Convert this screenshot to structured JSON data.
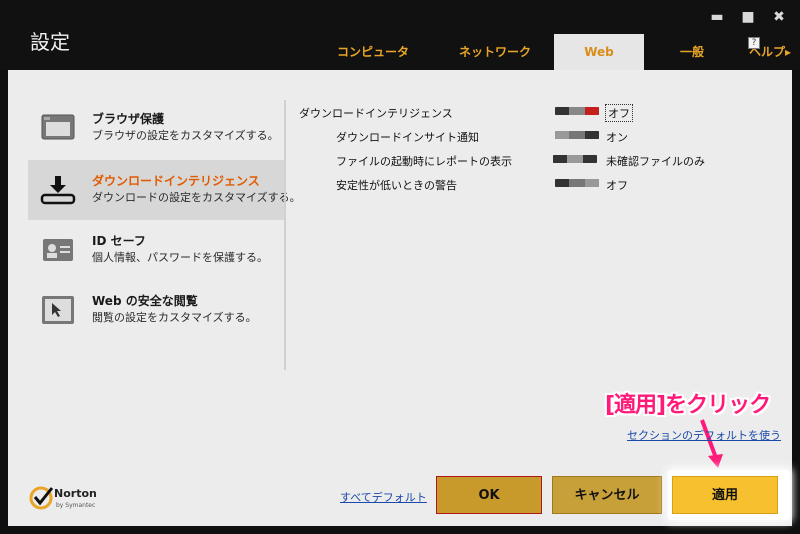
{
  "window": {
    "title": "設定",
    "controls": {
      "minimize": "▬",
      "maximize": "■",
      "close": "✖"
    }
  },
  "tabs": [
    {
      "label": "コンピュータ",
      "active": false
    },
    {
      "label": "ネットワーク",
      "active": false
    },
    {
      "label": "Web",
      "active": true
    },
    {
      "label": "一般",
      "active": false
    },
    {
      "label": "ヘルプ",
      "active": false,
      "suffix": "▸"
    }
  ],
  "sidebar": {
    "items": [
      {
        "title": "ブラウザ保護",
        "desc": "ブラウザの設定をカスタマイズする。",
        "icon": "browser-window-icon",
        "active": false
      },
      {
        "title": "ダウンロードインテリジェンス",
        "desc": "ダウンロードの設定をカスタマイズする。",
        "icon": "download-tray-icon",
        "active": true
      },
      {
        "title": "ID セーフ",
        "desc": "個人情報、パスワードを保護する。",
        "icon": "id-card-icon",
        "active": false
      },
      {
        "title": "Web の安全な閲覧",
        "desc": "閲覧の設定をカスタマイズする。",
        "icon": "cursor-window-icon",
        "active": false
      }
    ]
  },
  "settings": {
    "rows": [
      {
        "label": "ダウンロードインテリジェンス",
        "value": "オフ",
        "state": "off-red"
      },
      {
        "label": "ダウンロードインサイト通知",
        "value": "オン",
        "state": "on"
      },
      {
        "label": "ファイルの起動時にレポートの表示",
        "value": "未確認ファイルのみ",
        "state": "middle"
      },
      {
        "label": "安定性が低いときの警告",
        "value": "オフ",
        "state": "off"
      }
    ],
    "help": "?"
  },
  "annotation": {
    "text": "[適用]をクリック"
  },
  "links": {
    "section_default": "セクションのデフォルトを使う",
    "all_default": "すべてデフォルト"
  },
  "branding": {
    "name": "Norton",
    "sub": "by Symantec"
  },
  "buttons": {
    "ok": "OK",
    "cancel": "キャンセル",
    "apply": "適用"
  },
  "colors": {
    "accent": "#e8a526",
    "active_side_title": "#e05a00",
    "annotation": "#ff1a7a",
    "apply_button": "#f6c02e"
  }
}
